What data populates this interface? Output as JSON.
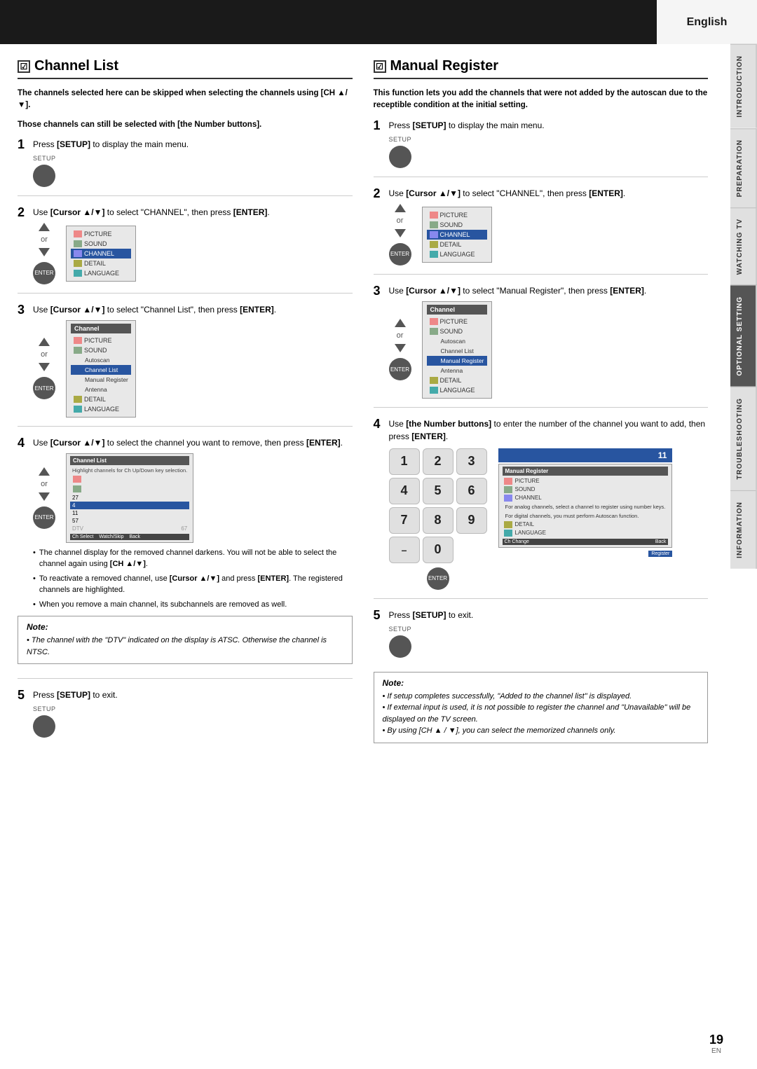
{
  "header": {
    "language": "English"
  },
  "side_tabs": [
    {
      "label": "INTRODUCTION",
      "active": false
    },
    {
      "label": "PREPARATION",
      "active": false
    },
    {
      "label": "WATCHING TV",
      "active": false
    },
    {
      "label": "OPTIONAL SETTING",
      "active": true
    },
    {
      "label": "TROUBLESHOOTING",
      "active": false
    },
    {
      "label": "INFORMATION",
      "active": false
    }
  ],
  "channel_list": {
    "title": "Channel List",
    "intro1": "The channels selected here can be skipped when selecting the channels using [CH ▲/▼].",
    "intro2": "Those channels can still be selected with [the Number buttons].",
    "steps": [
      {
        "num": "1",
        "text": "Press [SETUP] to display the main menu.",
        "btn_label": "SETUP"
      },
      {
        "num": "2",
        "text": "Use [Cursor ▲/▼] to select \"CHANNEL\", then press [ENTER].",
        "or": "or"
      },
      {
        "num": "3",
        "text": "Use [Cursor ▲/▼] to select \"Channel List\", then press [ENTER].",
        "or": "or"
      },
      {
        "num": "4",
        "text": "Use [Cursor ▲/▼] to select the channel you want to remove, then press [ENTER].",
        "or": "or"
      }
    ],
    "bullets": [
      "The channel display for the removed channel darkens. You will not be able to select the channel again using [CH ▲/▼].",
      "To reactivate a removed channel, use [Cursor ▲/▼] and press [ENTER]. The registered channels are highlighted.",
      "When you remove a main channel, its subchannels are removed as well."
    ],
    "note_title": "Note:",
    "note_items": [
      "The channel with the \"DTV\" indicated on the display is ATSC. Otherwise the channel is NTSC."
    ],
    "step5_text": "Press [SETUP] to exit.",
    "step5_btn": "SETUP"
  },
  "manual_register": {
    "title": "Manual Register",
    "intro": "This function lets you add the channels that were not added by the autoscan due to the receptible condition at the initial setting.",
    "steps": [
      {
        "num": "1",
        "text": "Press [SETUP] to display the main menu.",
        "btn_label": "SETUP"
      },
      {
        "num": "2",
        "text": "Use [Cursor ▲/▼] to select \"CHANNEL\", then press [ENTER].",
        "or": "or"
      },
      {
        "num": "3",
        "text": "Use [Cursor ▲/▼] to select \"Manual Register\", then press [ENTER].",
        "or": "or"
      },
      {
        "num": "4",
        "text": "Use [the Number buttons] to enter the number of the channel you want to add, then press [ENTER]."
      }
    ],
    "numpad": [
      "1",
      "2",
      "3",
      "4",
      "5",
      "6",
      "7",
      "8",
      "9",
      "–",
      "0"
    ],
    "step5_text": "Press [SETUP] to exit.",
    "step5_btn": "SETUP",
    "note_title": "Note:",
    "note_items": [
      "If setup completes successfully, \"Added to the channel list\" is displayed.",
      "If external input is used, it is not possible to register the channel and \"Unavailable\" will be displayed on the TV screen.",
      "By using [CH ▲ / ▼], you can select the memorized channels only."
    ]
  },
  "page_number": "19",
  "page_en": "EN",
  "menu_items": [
    "PICTURE",
    "SOUND",
    "CHANNEL",
    "DETAIL",
    "LANGUAGE"
  ],
  "channel_submenu": [
    "Autoscan",
    "Channel List",
    "Manual Register",
    "Antenna"
  ],
  "channel_list_entries": [
    "27",
    "4",
    "11",
    "57",
    "67"
  ],
  "channel_dtv_label": "DTV",
  "channel_number_display": "11"
}
